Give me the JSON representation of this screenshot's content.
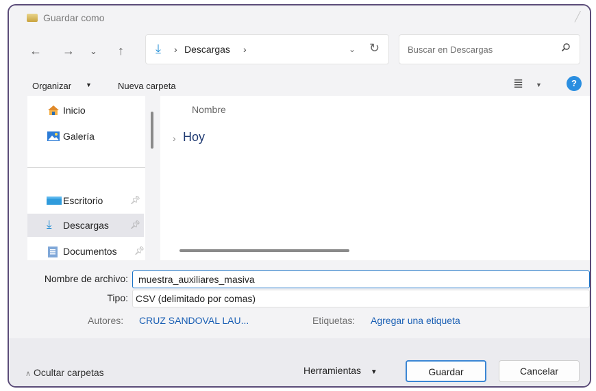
{
  "window": {
    "title": "Guardar como"
  },
  "address_bar": {
    "crumb": "Descargas",
    "separator": "›"
  },
  "search": {
    "placeholder": "Buscar en Descargas"
  },
  "toolbar": {
    "organize_label": "Organizar",
    "new_folder_label": "Nueva carpeta",
    "view_icon": "list-view-icon",
    "help_label": "?"
  },
  "nav_pane": {
    "items": [
      {
        "label": "Inicio",
        "icon": "home-icon",
        "pinned": false,
        "selected": false
      },
      {
        "label": "Galería",
        "icon": "gallery-icon",
        "pinned": false,
        "selected": false
      },
      {
        "label": "Escritorio",
        "icon": "desktop-icon",
        "pinned": true,
        "selected": false
      },
      {
        "label": "Descargas",
        "icon": "download-icon",
        "pinned": true,
        "selected": true
      },
      {
        "label": "Documentos",
        "icon": "documents-icon",
        "pinned": true,
        "selected": false
      }
    ]
  },
  "file_list": {
    "column_name": "Nombre",
    "group_label": "Hoy"
  },
  "form": {
    "filename_label": "Nombre de archivo:",
    "filename_value": "muestra_auxiliares_masiva",
    "type_label": "Tipo:",
    "type_value": "CSV (delimitado por comas)",
    "authors_label": "Autores:",
    "authors_value": "CRUZ SANDOVAL LAU...",
    "tags_label": "Etiquetas:",
    "tags_value": "Agregar una etiqueta"
  },
  "footer": {
    "hide_folders_label": "Ocultar carpetas",
    "tools_label": "Herramientas",
    "save_label": "Guardar",
    "cancel_label": "Cancelar"
  },
  "colors": {
    "accent": "#1a73c8",
    "link": "#1a5fb4",
    "frame": "#5a4b78"
  }
}
